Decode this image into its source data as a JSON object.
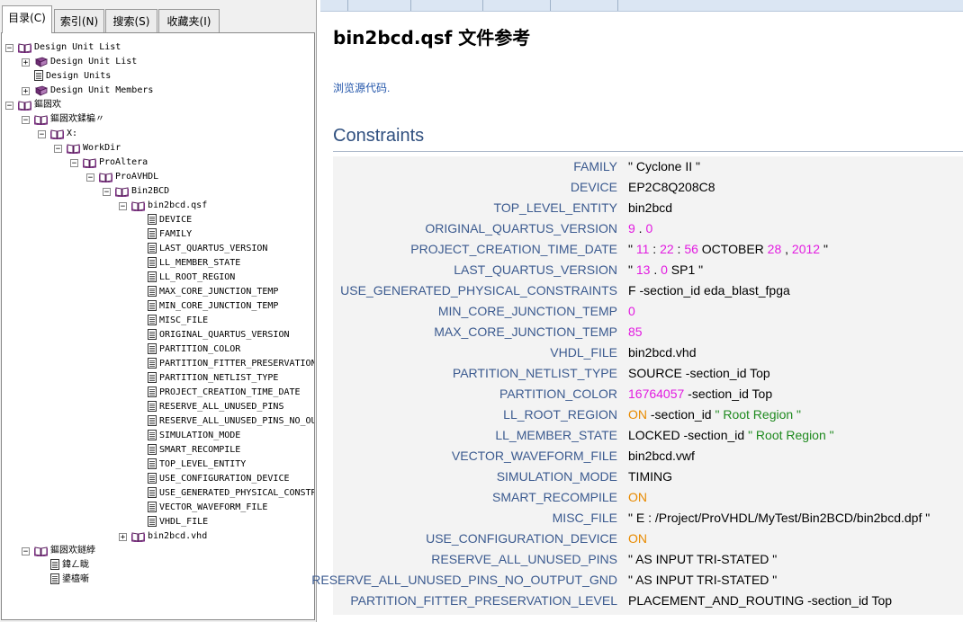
{
  "tabs": [
    {
      "label": "目录(C)",
      "active": true
    },
    {
      "label": "索引(N)",
      "active": false
    },
    {
      "label": "搜索(S)",
      "active": false
    },
    {
      "label": "收藏夹(I)",
      "active": false
    }
  ],
  "tree": [
    {
      "label": "Design Unit List",
      "depth": 0,
      "expander": "−",
      "icon": "book-open"
    },
    {
      "label": "Design Unit List",
      "depth": 1,
      "expander": "+",
      "icon": "book-closed"
    },
    {
      "label": "Design Units",
      "depth": 1,
      "expander": "",
      "icon": "page"
    },
    {
      "label": "Design Unit Members",
      "depth": 1,
      "expander": "+",
      "icon": "book-closed"
    },
    {
      "label": "鏂囦欢",
      "depth": 0,
      "expander": "−",
      "icon": "book-open"
    },
    {
      "label": "鏂囦欢鍒楄〃",
      "depth": 1,
      "expander": "−",
      "icon": "book-open"
    },
    {
      "label": "X:",
      "depth": 2,
      "expander": "−",
      "icon": "book-open"
    },
    {
      "label": "WorkDir",
      "depth": 3,
      "expander": "−",
      "icon": "book-open"
    },
    {
      "label": "ProAltera",
      "depth": 4,
      "expander": "−",
      "icon": "book-open"
    },
    {
      "label": "ProAVHDL",
      "depth": 5,
      "expander": "−",
      "icon": "book-open"
    },
    {
      "label": "Bin2BCD",
      "depth": 6,
      "expander": "−",
      "icon": "book-open"
    },
    {
      "label": "bin2bcd.qsf",
      "depth": 7,
      "expander": "−",
      "icon": "book-open"
    },
    {
      "label": "DEVICE",
      "depth": 8,
      "expander": "",
      "icon": "page"
    },
    {
      "label": "FAMILY",
      "depth": 8,
      "expander": "",
      "icon": "page"
    },
    {
      "label": "LAST_QUARTUS_VERSION",
      "depth": 8,
      "expander": "",
      "icon": "page"
    },
    {
      "label": "LL_MEMBER_STATE",
      "depth": 8,
      "expander": "",
      "icon": "page"
    },
    {
      "label": "LL_ROOT_REGION",
      "depth": 8,
      "expander": "",
      "icon": "page"
    },
    {
      "label": "MAX_CORE_JUNCTION_TEMP",
      "depth": 8,
      "expander": "",
      "icon": "page"
    },
    {
      "label": "MIN_CORE_JUNCTION_TEMP",
      "depth": 8,
      "expander": "",
      "icon": "page"
    },
    {
      "label": "MISC_FILE",
      "depth": 8,
      "expander": "",
      "icon": "page"
    },
    {
      "label": "ORIGINAL_QUARTUS_VERSION",
      "depth": 8,
      "expander": "",
      "icon": "page"
    },
    {
      "label": "PARTITION_COLOR",
      "depth": 8,
      "expander": "",
      "icon": "page"
    },
    {
      "label": "PARTITION_FITTER_PRESERVATION_LEVEL",
      "depth": 8,
      "expander": "",
      "icon": "page"
    },
    {
      "label": "PARTITION_NETLIST_TYPE",
      "depth": 8,
      "expander": "",
      "icon": "page"
    },
    {
      "label": "PROJECT_CREATION_TIME_DATE",
      "depth": 8,
      "expander": "",
      "icon": "page"
    },
    {
      "label": "RESERVE_ALL_UNUSED_PINS",
      "depth": 8,
      "expander": "",
      "icon": "page"
    },
    {
      "label": "RESERVE_ALL_UNUSED_PINS_NO_OUTPUT_GND",
      "depth": 8,
      "expander": "",
      "icon": "page"
    },
    {
      "label": "SIMULATION_MODE",
      "depth": 8,
      "expander": "",
      "icon": "page"
    },
    {
      "label": "SMART_RECOMPILE",
      "depth": 8,
      "expander": "",
      "icon": "page"
    },
    {
      "label": "TOP_LEVEL_ENTITY",
      "depth": 8,
      "expander": "",
      "icon": "page"
    },
    {
      "label": "USE_CONFIGURATION_DEVICE",
      "depth": 8,
      "expander": "",
      "icon": "page"
    },
    {
      "label": "USE_GENERATED_PHYSICAL_CONSTRAINTS",
      "depth": 8,
      "expander": "",
      "icon": "page"
    },
    {
      "label": "VECTOR_WAVEFORM_FILE",
      "depth": 8,
      "expander": "",
      "icon": "page"
    },
    {
      "label": "VHDL_FILE",
      "depth": 8,
      "expander": "",
      "icon": "page"
    },
    {
      "label": "bin2bcd.vhd",
      "depth": 7,
      "expander": "+",
      "icon": "book-open"
    },
    {
      "label": "鏂囦欢鐩綍",
      "depth": 1,
      "expander": "−",
      "icon": "book-open"
    },
    {
      "label": "鍏ㄥ眬",
      "depth": 2,
      "expander": "",
      "icon": "page"
    },
    {
      "label": "鍙橀噺",
      "depth": 2,
      "expander": "",
      "icon": "page"
    }
  ],
  "page": {
    "title": "bin2bcd.qsf 文件参考",
    "source_link": "浏览源代码.",
    "section_header": "Constraints"
  },
  "constraints": [
    {
      "key": "FAMILY",
      "value": [
        [
          "k",
          "\" Cyclone II \""
        ]
      ]
    },
    {
      "key": "DEVICE",
      "value": [
        [
          "k",
          "EP2C8Q208C8"
        ]
      ]
    },
    {
      "key": "TOP_LEVEL_ENTITY",
      "value": [
        [
          "k",
          "bin2bcd"
        ]
      ]
    },
    {
      "key": "ORIGINAL_QUARTUS_VERSION",
      "value": [
        [
          "n",
          "9"
        ],
        [
          "k",
          " . "
        ],
        [
          "n",
          "0"
        ]
      ]
    },
    {
      "key": "PROJECT_CREATION_TIME_DATE",
      "value": [
        [
          "k",
          "\" "
        ],
        [
          "n",
          "11"
        ],
        [
          "k",
          " : "
        ],
        [
          "n",
          "22"
        ],
        [
          "k",
          " : "
        ],
        [
          "n",
          "56"
        ],
        [
          "k",
          " OCTOBER "
        ],
        [
          "n",
          "28"
        ],
        [
          "k",
          " , "
        ],
        [
          "n",
          "2012"
        ],
        [
          "k",
          " \""
        ]
      ]
    },
    {
      "key": "LAST_QUARTUS_VERSION",
      "value": [
        [
          "k",
          "\" "
        ],
        [
          "n",
          "13"
        ],
        [
          "k",
          " . "
        ],
        [
          "n",
          "0"
        ],
        [
          "k",
          " SP1 \""
        ]
      ]
    },
    {
      "key": "USE_GENERATED_PHYSICAL_CONSTRAINTS",
      "value": [
        [
          "k",
          "F -section_id eda_blast_fpga"
        ]
      ]
    },
    {
      "key": "MIN_CORE_JUNCTION_TEMP",
      "value": [
        [
          "n",
          "0"
        ]
      ]
    },
    {
      "key": "MAX_CORE_JUNCTION_TEMP",
      "value": [
        [
          "n",
          "85"
        ]
      ]
    },
    {
      "key": "VHDL_FILE",
      "value": [
        [
          "k",
          "bin2bcd.vhd"
        ]
      ]
    },
    {
      "key": "PARTITION_NETLIST_TYPE",
      "value": [
        [
          "k",
          "SOURCE -section_id Top"
        ]
      ]
    },
    {
      "key": "PARTITION_COLOR",
      "value": [
        [
          "n",
          "16764057"
        ],
        [
          "k",
          " -section_id Top"
        ]
      ]
    },
    {
      "key": "LL_ROOT_REGION",
      "value": [
        [
          "o",
          "ON"
        ],
        [
          "k",
          " -section_id "
        ],
        [
          "s",
          "\" Root Region \""
        ]
      ]
    },
    {
      "key": "LL_MEMBER_STATE",
      "value": [
        [
          "k",
          "LOCKED -section_id "
        ],
        [
          "s",
          "\" Root Region \""
        ]
      ]
    },
    {
      "key": "VECTOR_WAVEFORM_FILE",
      "value": [
        [
          "k",
          "bin2bcd.vwf"
        ]
      ]
    },
    {
      "key": "SIMULATION_MODE",
      "value": [
        [
          "k",
          "TIMING"
        ]
      ]
    },
    {
      "key": "SMART_RECOMPILE",
      "value": [
        [
          "o",
          "ON"
        ]
      ]
    },
    {
      "key": "MISC_FILE",
      "value": [
        [
          "k",
          "\" E : /Project/ProVHDL/MyTest/Bin2BCD/bin2bcd.dpf \""
        ]
      ]
    },
    {
      "key": "USE_CONFIGURATION_DEVICE",
      "value": [
        [
          "o",
          "ON"
        ]
      ]
    },
    {
      "key": "RESERVE_ALL_UNUSED_PINS",
      "value": [
        [
          "k",
          "\" AS INPUT TRI-STATED \""
        ]
      ]
    },
    {
      "key": "RESERVE_ALL_UNUSED_PINS_NO_OUTPUT_GND",
      "value": [
        [
          "k",
          "\" AS INPUT TRI-STATED \""
        ]
      ]
    },
    {
      "key": "PARTITION_FITTER_PRESERVATION_LEVEL",
      "value": [
        [
          "k",
          "PLACEMENT_AND_ROUTING -section_id Top"
        ]
      ]
    }
  ],
  "colors": {
    "key_text": "#3b5a8f",
    "number": "#e21be0",
    "keyword_on": "#e88a00",
    "string": "#1f8a1f",
    "header": "#2f4f7f",
    "link": "#2255aa"
  }
}
